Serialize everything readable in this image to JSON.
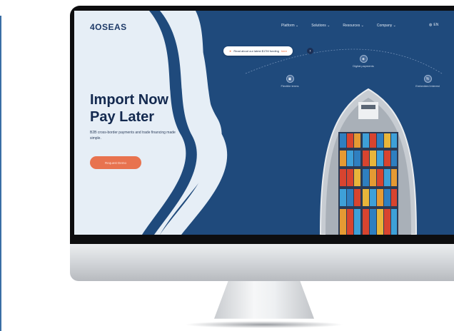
{
  "website": {
    "brand": "4OSEAS",
    "nav": [
      {
        "label": "Platform ⌄"
      },
      {
        "label": "Solutions ⌄"
      },
      {
        "label": "Resources ⌄"
      },
      {
        "label": "Company ⌄"
      }
    ],
    "language": "EN",
    "news": {
      "text": "Read about our latest $17M funding",
      "link": "here"
    },
    "hero": {
      "title_line1": "Import Now",
      "title_line2": "Pay Later",
      "subtitle": "B2B cross-border payments and trade financing made simple.",
      "cta": "Request Demo"
    },
    "features": [
      {
        "label": "Flexible terms"
      },
      {
        "label": "Digital payments"
      },
      {
        "label": "Embedded interest"
      }
    ]
  },
  "colors": {
    "navy": "#1f4a7c",
    "deep_navy": "#13294f",
    "accent": "#e8734f",
    "light_bg": "#e6eef6"
  }
}
